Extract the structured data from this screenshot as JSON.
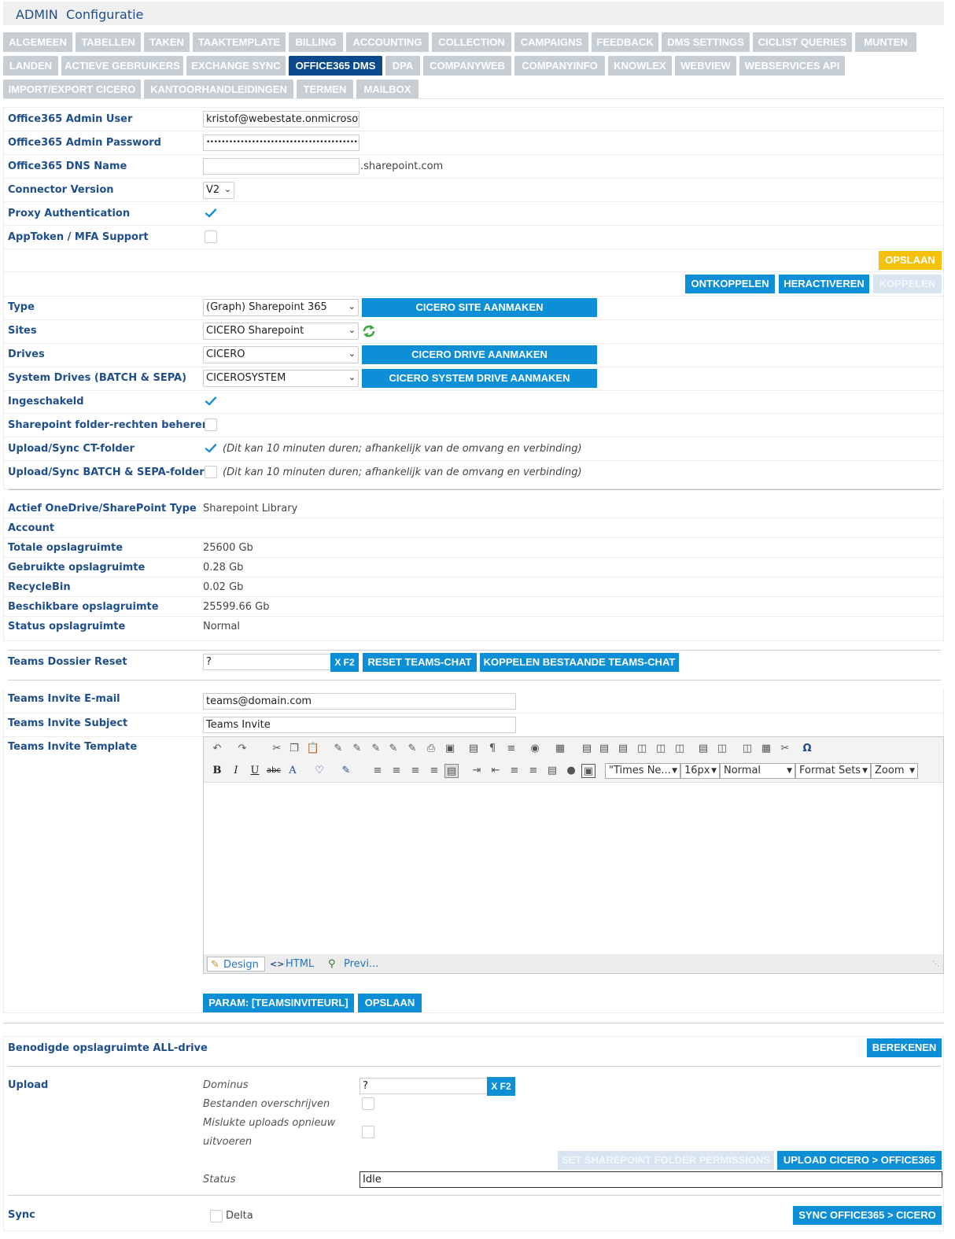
{
  "header": {
    "prefix": "ADMIN",
    "title": "Configuratie"
  },
  "tabs": {
    "row1": [
      "ALGEMEEN",
      "TABELLEN",
      "TAKEN",
      "TAAKTEMPLATE",
      "BILLING",
      "ACCOUNTING",
      "COLLECTION",
      "CAMPAIGNS",
      "FEEDBACK",
      "DMS SETTINGS",
      "CICLIST QUERIES",
      "MUNTEN"
    ],
    "row2": [
      "LANDEN",
      "ACTIEVE GEBRUIKERS",
      "EXCHANGE SYNC",
      "OFFICE365 DMS",
      "DPA",
      "COMPANYWEB",
      "COMPANYINFO",
      "KNOWLEX",
      "WEBVIEW",
      "WEBSERVICES API"
    ],
    "row3": [
      "IMPORT/EXPORT CICERO",
      "KANTOORHANDLEIDINGEN",
      "TERMEN",
      "MAILBOX"
    ],
    "active": "OFFICE365 DMS"
  },
  "settings": {
    "admin_user_label": "Office365 Admin User",
    "admin_user_value": "kristof@webestate.onmicrosoft",
    "admin_password_label": "Office365 Admin Password",
    "admin_password_value": "•••••••••••••••••••••••••••••••••••••••••••••••",
    "dns_label": "Office365 DNS Name",
    "dns_value": "",
    "dns_suffix": ".sharepoint.com",
    "connector_label": "Connector Version",
    "connector_value": "V2",
    "proxy_label": "Proxy Authentication",
    "proxy_checked": true,
    "apptoken_label": "AppToken / MFA Support",
    "apptoken_checked": false,
    "save_button": "OPSLAAN"
  },
  "connection": {
    "ontkoppelen": "ONTKOPPELEN",
    "heractiveren": "HERACTIVEREN",
    "koppelen": "KOPPELEN",
    "type_label": "Type",
    "type_value": "(Graph) Sharepoint 365",
    "site_button": "CICERO SITE AANMAKEN",
    "sites_label": "Sites",
    "sites_value": "CICERO Sharepoint",
    "drives_label": "Drives",
    "drives_value": "CICERO",
    "drive_button": "CICERO DRIVE AANMAKEN",
    "system_drives_label": "System Drives (BATCH & SEPA)",
    "system_drives_value": "CICEROSYSTEM",
    "system_drive_button": "CICERO SYSTEM DRIVE AANMAKEN",
    "enabled_label": "Ingeschakeld",
    "enabled_checked": true,
    "rights_label": "Sharepoint folder-rechten beheren",
    "rights_checked": false,
    "ct_label": "Upload/Sync CT-folder",
    "ct_checked": true,
    "ct_note": "(Dit kan 10 minuten duren; afhankelijk van de omvang en verbinding)",
    "batch_label": "Upload/Sync BATCH & SEPA-folder",
    "batch_checked": false,
    "batch_note": "(Dit kan 10 minuten duren; afhankelijk van de omvang en verbinding)"
  },
  "storage": {
    "type_label": "Actief OneDrive/SharePoint Type",
    "type_value": "Sharepoint Library",
    "account_label": "Account",
    "account_value": "",
    "total_label": "Totale opslagruimte",
    "total_value": "25600 Gb",
    "used_label": "Gebruikte opslagruimte",
    "used_value": "0.28 Gb",
    "recycle_label": "RecycleBin",
    "recycle_value": "0.02 Gb",
    "available_label": "Beschikbare opslagruimte",
    "available_value": "25599.66 Gb",
    "status_label": "Status opslagruimte",
    "status_value": "Normal"
  },
  "teams": {
    "reset_label": "Teams Dossier Reset",
    "reset_value": "?",
    "xf2": "X F2",
    "reset_button": "RESET TEAMS-CHAT",
    "link_button": "KOPPELEN BESTAANDE TEAMS-CHAT",
    "invite_email_label": "Teams Invite E-mail",
    "invite_email_value": "teams@domain.com",
    "invite_subject_label": "Teams Invite Subject",
    "invite_subject_value": "Teams Invite",
    "invite_template_label": "Teams Invite Template",
    "param_button": "PARAM: [TEAMSINVITEURL]",
    "save_button": "OPSLAAN"
  },
  "editor": {
    "font_family": "\"Times Ne...",
    "font_size": "16px",
    "paragraph": "Normal",
    "format_sets": "Format Sets",
    "zoom": "Zoom",
    "tab_design": "Design",
    "tab_html": "HTML",
    "tab_preview": "Previ..."
  },
  "allDrive": {
    "label": "Benodigde opslagruimte ALL-drive",
    "calc_button": "BEREKENEN",
    "upload_label": "Upload",
    "dominus_label": "Dominus",
    "dominus_value": "?",
    "xf2": "X F2",
    "overwrite_label": "Bestanden overschrijven",
    "retry_label_1": "Mislukte uploads opnieuw",
    "retry_label_2": "uitvoeren",
    "permissions_button": "SET SHAREPOINT FOLDER PERMISSIONS",
    "upload_button": "UPLOAD CICERO > OFFICE365",
    "status_label": "Status",
    "status_value": "Idle",
    "sync_label": "Sync",
    "delta_label": "Delta",
    "sync_button": "SYNC OFFICE365 > CICERO"
  },
  "colors": {
    "accent": "#0c8fd6",
    "save": "#f4c20d",
    "label": "#1f4e8c",
    "tab_inactive": "#c6ced4",
    "tab_active": "#0a4a8c"
  }
}
